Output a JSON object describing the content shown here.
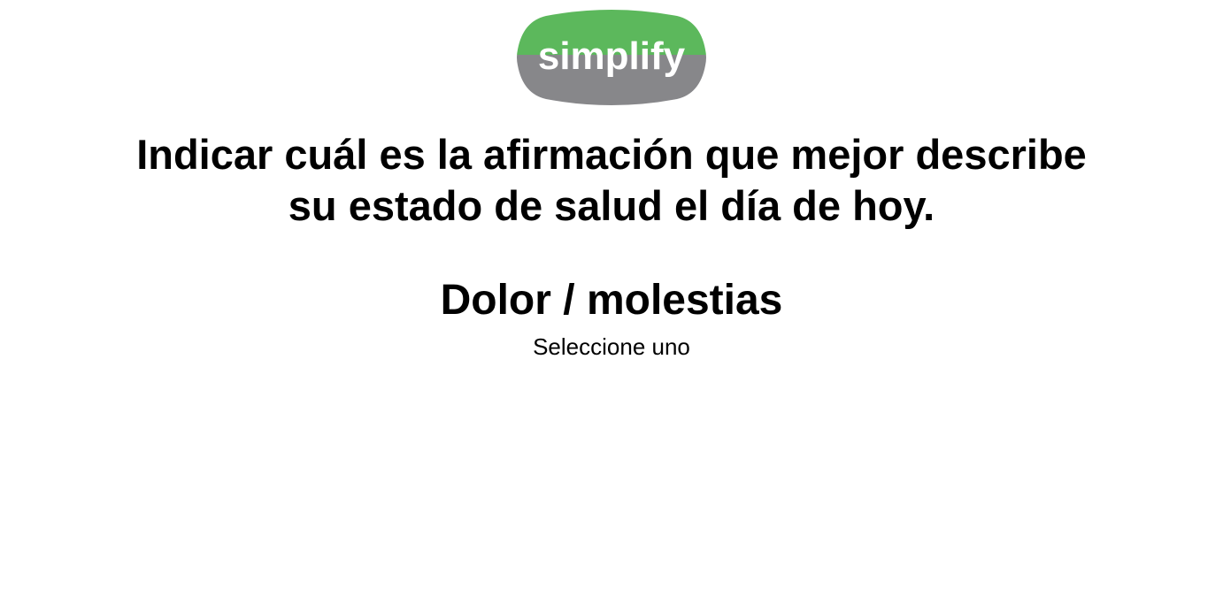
{
  "logo": {
    "text": "simplify",
    "colors": {
      "top": "#5cb85c",
      "bottom": "#87878a",
      "text": "#ffffff"
    }
  },
  "question": {
    "line1": "Indicar cuál es la afirmación que mejor describe",
    "line2": "su estado de salud el día de hoy."
  },
  "dimension": {
    "title": "Dolor / molestias",
    "instruction": "Seleccione uno"
  }
}
